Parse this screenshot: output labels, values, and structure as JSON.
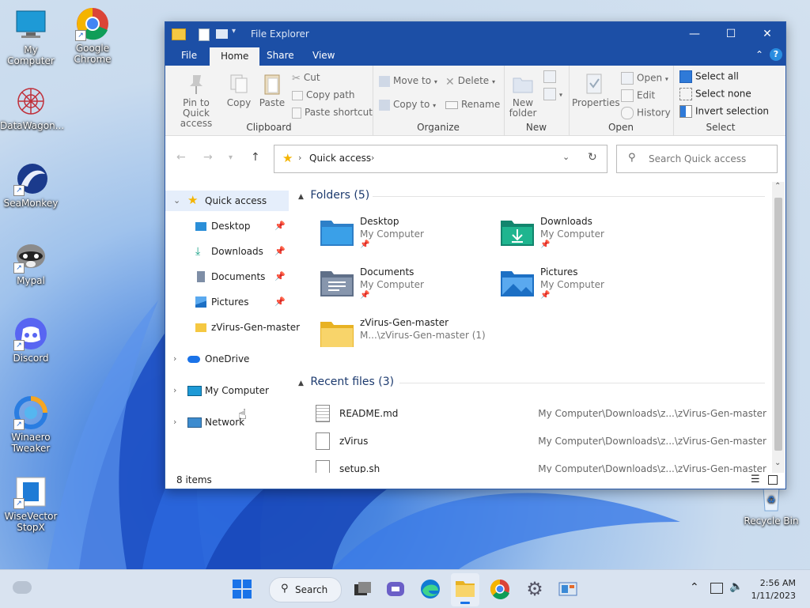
{
  "desktop": {
    "icons": [
      {
        "label": "My Computer"
      },
      {
        "label": "Google Chrome"
      },
      {
        "label": "DataWagon..."
      },
      {
        "label": "SeaMonkey"
      },
      {
        "label": "Mypal"
      },
      {
        "label": "Discord"
      },
      {
        "label": "Winaero Tweaker"
      },
      {
        "label": "WiseVector StopX"
      },
      {
        "label": "Recycle Bin"
      }
    ]
  },
  "window": {
    "title": "File Explorer",
    "controls": {
      "minimize": "—",
      "maximize": "☐",
      "close": "✕"
    },
    "tabs": [
      {
        "label": "File"
      },
      {
        "label": "Home"
      },
      {
        "label": "Share"
      },
      {
        "label": "View"
      }
    ],
    "ribbon": {
      "clipboard": {
        "label": "Clipboard",
        "pin_to_quick_access": "Pin to Quick access",
        "copy": "Copy",
        "paste": "Paste",
        "cut": "Cut",
        "copy_path": "Copy path",
        "paste_shortcut": "Paste shortcut"
      },
      "organize": {
        "label": "Organize",
        "move_to": "Move to",
        "copy_to": "Copy to",
        "delete": "Delete",
        "rename": "Rename"
      },
      "new": {
        "label": "New",
        "new_folder": "New folder"
      },
      "open": {
        "label": "Open",
        "properties": "Properties",
        "open": "Open",
        "edit": "Edit",
        "history": "History"
      },
      "select": {
        "label": "Select",
        "select_all": "Select all",
        "select_none": "Select none",
        "invert_selection": "Invert selection"
      }
    },
    "address": {
      "path": "Quick access"
    },
    "search": {
      "placeholder": "Search Quick access"
    },
    "nav": {
      "quick_access": "Quick access",
      "items": [
        {
          "label": "Desktop"
        },
        {
          "label": "Downloads"
        },
        {
          "label": "Documents"
        },
        {
          "label": "Pictures"
        },
        {
          "label": "zVirus-Gen-master"
        }
      ],
      "onedrive": "OneDrive",
      "my_computer": "My Computer",
      "network": "Network"
    },
    "folders_header": "Folders (5)",
    "folders": [
      {
        "name": "Desktop",
        "location": "My Computer"
      },
      {
        "name": "Downloads",
        "location": "My Computer"
      },
      {
        "name": "Documents",
        "location": "My Computer"
      },
      {
        "name": "Pictures",
        "location": "My Computer"
      },
      {
        "name": "zVirus-Gen-master",
        "location": "M...\\zVirus-Gen-master (1)"
      }
    ],
    "recent_header": "Recent files (3)",
    "recent": [
      {
        "name": "README.md",
        "path": "My Computer\\Downloads\\z...\\zVirus-Gen-master"
      },
      {
        "name": "zVirus",
        "path": "My Computer\\Downloads\\z...\\zVirus-Gen-master"
      },
      {
        "name": "setup.sh",
        "path": "My Computer\\Downloads\\z...\\zVirus-Gen-master"
      }
    ],
    "status": "8 items"
  },
  "taskbar": {
    "search_label": "Search",
    "time": "2:56 AM",
    "date": "1/11/2023"
  },
  "colors": {
    "titlebar": "#1c4fa6",
    "accent": "#1a73e8",
    "folder_yellow": "#f5c842"
  }
}
